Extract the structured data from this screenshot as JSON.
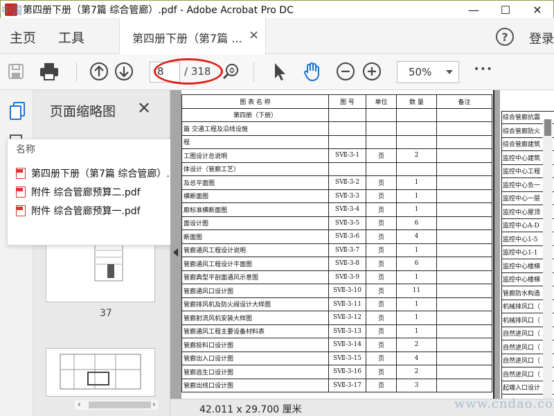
{
  "window": {
    "title": "第四册下册（第7篇 综合管廊）.pdf - Adobe Acrobat Pro DC",
    "minimize": "—",
    "maximize": "☐",
    "close": "✕"
  },
  "menu": {
    "home": "主页",
    "tools": "工具",
    "doc_tab": "第四册下册（第7篇 ...",
    "doc_tab_close": "×",
    "help": "?",
    "login": "登录"
  },
  "toolbar": {
    "page_current": "8",
    "page_total": "/ 318",
    "zoom": "50%",
    "more": "•••",
    "highlight_color": "#e0201a"
  },
  "thumbnails": {
    "title": "页面缩略图",
    "close": "✕",
    "page_label": "37"
  },
  "attachments": {
    "header": "名称",
    "items": [
      "第四册下册（第7篇 综合管廊）.pdf",
      "附件 综合管廊预算二.pdf",
      "附件 综合管廊预算一.pdf"
    ]
  },
  "document": {
    "header": [
      "图    表    名    称",
      "图  号",
      "单位",
      "数  量",
      "备注"
    ],
    "section": "第四册（下册）",
    "rows": [
      [
        "篇   交通工程及沿线设施",
        "",
        "",
        "",
        ""
      ],
      [
        "程",
        "",
        "",
        "",
        ""
      ],
      [
        "工图设计总说明",
        "SⅦ-3-1",
        "页",
        "2",
        ""
      ],
      [
        "体设计（管廊工艺）",
        "",
        "",
        "",
        ""
      ],
      [
        "及总平面图",
        "SⅦ-3-2",
        "页",
        "1",
        ""
      ],
      [
        "横断面图",
        "SⅦ-3-3",
        "页",
        "1",
        ""
      ],
      [
        "廊标准横断面图",
        "SⅦ-3-4",
        "页",
        "1",
        ""
      ],
      [
        "面设计图",
        "SⅦ-3-5",
        "页",
        "6",
        ""
      ],
      [
        "断面图",
        "SⅦ-3-6",
        "页",
        "4",
        ""
      ],
      [
        "管廊通风工程设计说明",
        "SⅦ-3-7",
        "页",
        "1",
        ""
      ],
      [
        "管廊通风工程设计平面图",
        "SⅦ-3-8",
        "页",
        "6",
        ""
      ],
      [
        "管廊典型平剖面通风示意图",
        "SⅦ-3-9",
        "页",
        "1",
        ""
      ],
      [
        "管廊通风口设计图",
        "SⅦ-3-10",
        "页",
        "11",
        ""
      ],
      [
        "管廊排风机及防火阀设计大样图",
        "SⅦ-3-11",
        "页",
        "1",
        ""
      ],
      [
        "管廊射流风机安装大样图",
        "SⅦ-3-12",
        "页",
        "1",
        ""
      ],
      [
        "管廊通风工程主要设备材料表",
        "SⅦ-3-13",
        "页",
        "1",
        ""
      ],
      [
        "管廊投料口设计图",
        "SⅦ-3-14",
        "页",
        "2",
        ""
      ],
      [
        "管廊出入口设计图",
        "SⅦ-3-15",
        "页",
        "4",
        ""
      ],
      [
        "管廊逃生口设计图",
        "SⅦ-3-16",
        "页",
        "2",
        ""
      ],
      [
        "管廊出线口设计图",
        "SⅦ-3-17",
        "页",
        "3",
        ""
      ]
    ],
    "page2_rows": [
      "综合管廊抗震",
      "综合管廊防火",
      "综合管廊建筑",
      "监控中心建筑",
      "监控中心工程",
      "监控中心负一",
      "监控中心一层",
      "监控中心屋顶",
      "监控中心A-D",
      "监控中心1-5",
      "监控中心1-1",
      "监控中心楼梯",
      "监控中心楼梯",
      "管廊防水构造",
      "机械排风口（",
      "机械排风口（",
      "自然进风口（",
      "自然进风口（",
      "自然进风口（",
      "自然进风口（",
      "起端入口设计"
    ]
  },
  "status": {
    "dimensions": "42.011 x 29.700 厘米"
  },
  "watermarks": {
    "top_left": "中国",
    "bottom_right": "www.cndao.com"
  }
}
